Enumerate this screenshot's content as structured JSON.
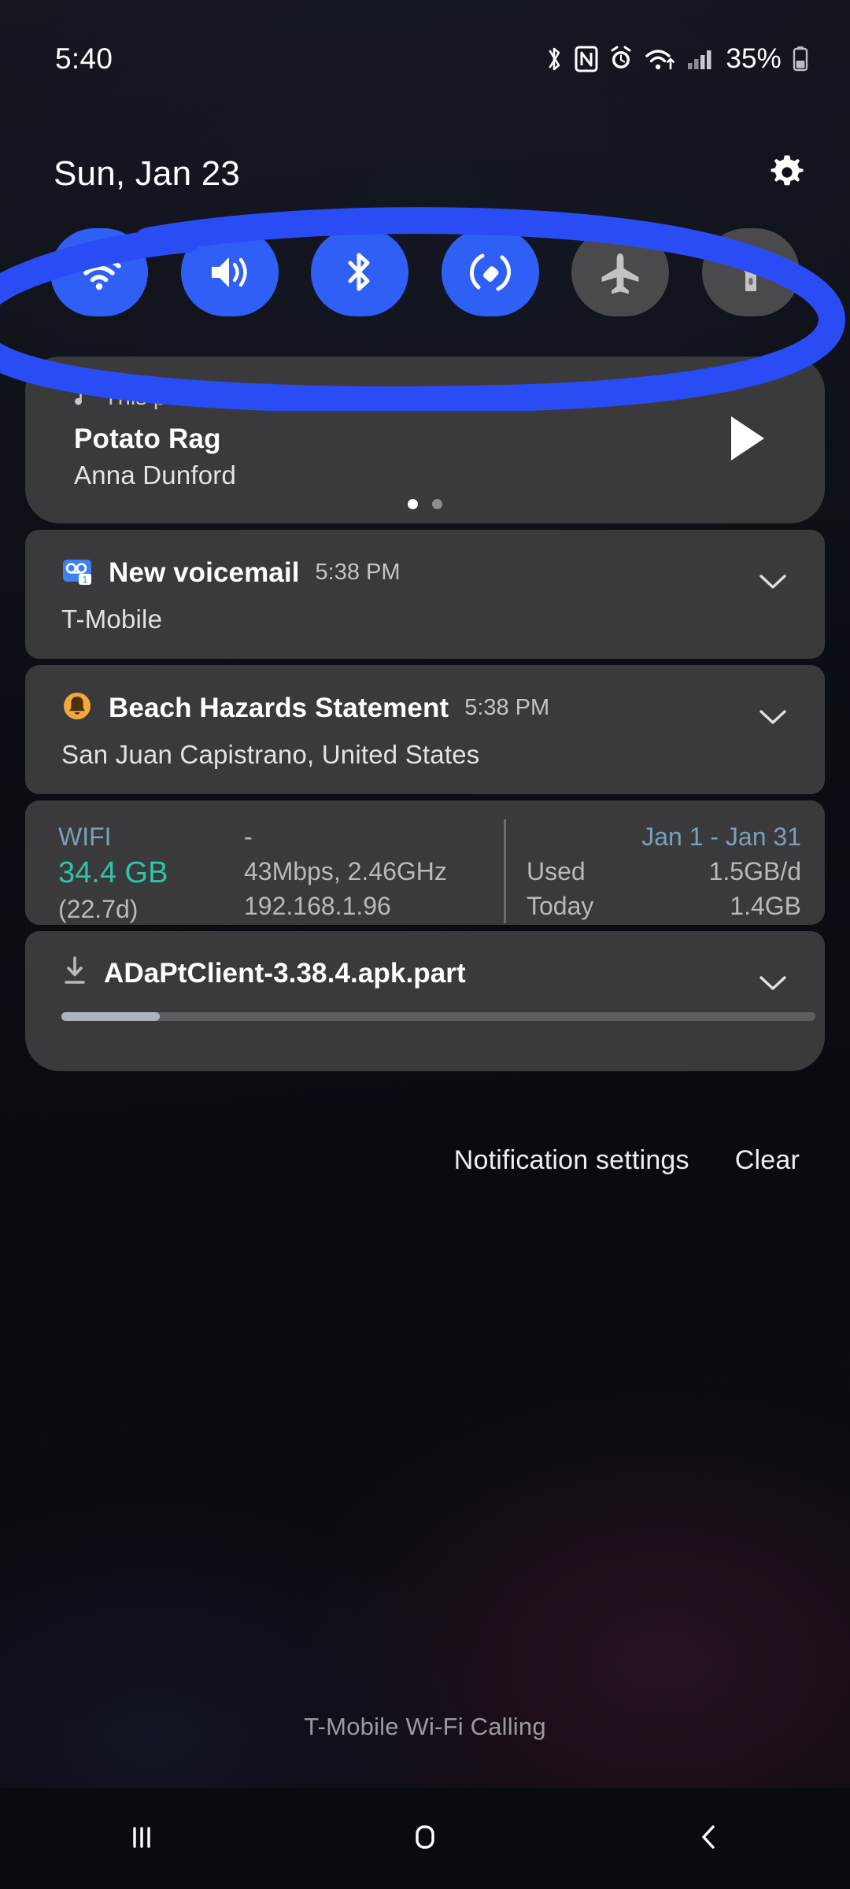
{
  "statusbar": {
    "time": "5:40",
    "battery_percent": "35%",
    "icons": [
      "bluetooth-icon",
      "nfc-icon",
      "alarm-icon",
      "wifi-icon",
      "cell-signal-icon",
      "battery-icon"
    ]
  },
  "header": {
    "date": "Sun, Jan 23",
    "settings_icon": "gear-icon"
  },
  "quick_settings": {
    "tiles": [
      {
        "name": "wifi",
        "icon": "wifi-icon",
        "active": true
      },
      {
        "name": "sound",
        "icon": "volume-icon",
        "active": true
      },
      {
        "name": "bluetooth",
        "icon": "bluetooth-icon",
        "active": true
      },
      {
        "name": "auto-rotate",
        "icon": "auto-rotate-icon",
        "active": true
      },
      {
        "name": "airplane-mode",
        "icon": "airplane-icon",
        "active": false
      },
      {
        "name": "flashlight",
        "icon": "flashlight-icon",
        "active": false
      }
    ],
    "active_color": "#2f5ff5",
    "inactive_color": "#4a4a4c"
  },
  "media": {
    "app_label": "This phone",
    "title": "Potato Rag",
    "artist": "Anna Dunford",
    "play_icon": "play-icon",
    "music_icon": "music-note-icon",
    "page_dots": 2,
    "active_dot": 0
  },
  "notifications": [
    {
      "id": "voicemail",
      "icon": "voicemail-icon",
      "title": "New voicemail",
      "time": "5:38 PM",
      "body": "T-Mobile",
      "expand_icon": "chevron-down-icon"
    },
    {
      "id": "beach-hazards",
      "icon": "alert-bell-icon",
      "title": "Beach Hazards Statement",
      "time": "5:38 PM",
      "body": "San Juan Capistrano, United States",
      "expand_icon": "chevron-down-icon"
    }
  ],
  "data_usage": {
    "col1": {
      "header": "WIFI",
      "value": "34.4 GB",
      "sub": "(22.7d)"
    },
    "col2": {
      "header": "-",
      "value": "43Mbps, 2.46GHz",
      "sub": "192.168.1.96"
    },
    "col3": {
      "header": "Jan 1 - Jan 31",
      "rows": [
        {
          "label": "Used",
          "value": "1.5GB/d"
        },
        {
          "label": "Today",
          "value": "1.4GB"
        }
      ]
    },
    "accent_teal": "#2ec4a8",
    "accent_blue": "#7aa7d8"
  },
  "download": {
    "icon": "download-icon",
    "filename": "ADaPtClient-3.38.4.apk.part",
    "progress_percent": 13,
    "expand_icon": "chevron-down-icon"
  },
  "footer": {
    "settings_label": "Notification settings",
    "clear_label": "Clear"
  },
  "carrier": {
    "label": "T-Mobile Wi-Fi Calling"
  },
  "navbar": {
    "recents_icon": "recents-icon",
    "home_icon": "home-icon",
    "back_icon": "back-icon"
  },
  "annotation": {
    "shape": "ellipse-circle-highlight",
    "color": "#2a4cf5"
  }
}
